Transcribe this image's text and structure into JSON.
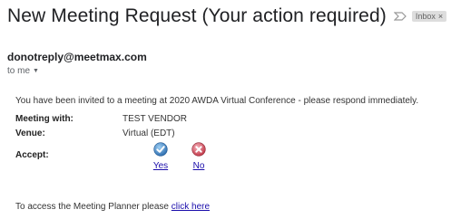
{
  "email": {
    "subject": "New Meeting Request (Your action required)",
    "label": "Inbox",
    "label_close": "×",
    "sender": "donotreply@meetmax.com",
    "recipient": "to me",
    "recipient_caret": "▼"
  },
  "body": {
    "intro": "You have been invited to a meeting at 2020 AWDA Virtual Conference - please respond immediately.",
    "meeting_with_label": "Meeting with:",
    "meeting_with_value": "TEST VENDOR",
    "venue_label": "Venue:",
    "venue_value": "Virtual (EDT)",
    "accept_label": "Accept:",
    "yes_label": "Yes",
    "no_label": "No",
    "footer_text": "To access the Meeting Planner please ",
    "footer_link": "click here"
  },
  "icons": {
    "importance": "importance-marker-icon",
    "yes": "checkmark-circle-icon",
    "no": "cross-circle-icon"
  },
  "colors": {
    "link": "#1a0dab",
    "yes_icon": "#2f6fb0",
    "no_icon": "#c23a4a",
    "label_chip": "#dddddd"
  }
}
